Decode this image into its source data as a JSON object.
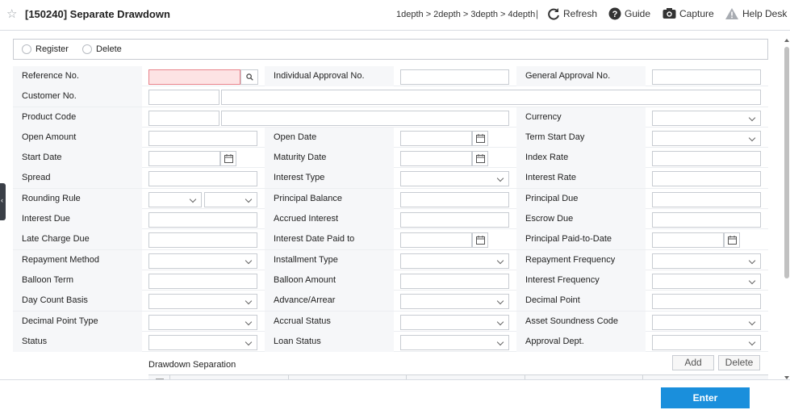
{
  "header": {
    "title": "[150240] Separate Drawdown",
    "breadcrumb": "1depth > 2depth > 3depth > 4depth",
    "separator": "|",
    "refresh_label": "Refresh",
    "guide_label": "Guide",
    "capture_label": "Capture",
    "helpdesk_label": "Help Desk"
  },
  "mode": {
    "register_label": "Register",
    "delete_label": "Delete"
  },
  "form": {
    "rows": [
      [
        "Reference No.",
        "Individual Approval No.",
        "General Approval No."
      ],
      [
        "Customer No.",
        "",
        ""
      ],
      [
        "Product Code",
        "",
        "Currency"
      ],
      [
        "Open Amount",
        "Open Date",
        "Term Start Day"
      ],
      [
        "Start Date",
        "Maturity Date",
        "Index Rate"
      ],
      [
        "Spread",
        "Interest Type",
        "Interest Rate"
      ],
      [
        "Rounding Rule",
        "Principal Balance",
        "Principal Due"
      ],
      [
        "Interest Due",
        "Accrued Interest",
        "Escrow Due"
      ],
      [
        "Late Charge Due",
        "Interest Date Paid to",
        "Principal Paid-to-Date"
      ],
      [
        "Repayment Method",
        "Installment Type",
        "Repayment Frequency"
      ],
      [
        "Balloon Term",
        "Balloon Amount",
        "Interest Frequency"
      ],
      [
        "Day Count Basis",
        "Advance/Arrear",
        "Decimal Point"
      ],
      [
        "Decimal Point Type",
        "Accrual Status",
        "Asset Soundness Code"
      ],
      [
        "Status",
        "Loan Status",
        "Approval Dept."
      ]
    ]
  },
  "drawdown": {
    "title": "Drawdown Separation",
    "add_label": "Add",
    "delete_label": "Delete"
  },
  "footer": {
    "enter_label": "Enter"
  },
  "colors": {
    "accent": "#1a8fdc",
    "required_field": "#fde3e4",
    "label_bg": "#f6f7f9"
  }
}
